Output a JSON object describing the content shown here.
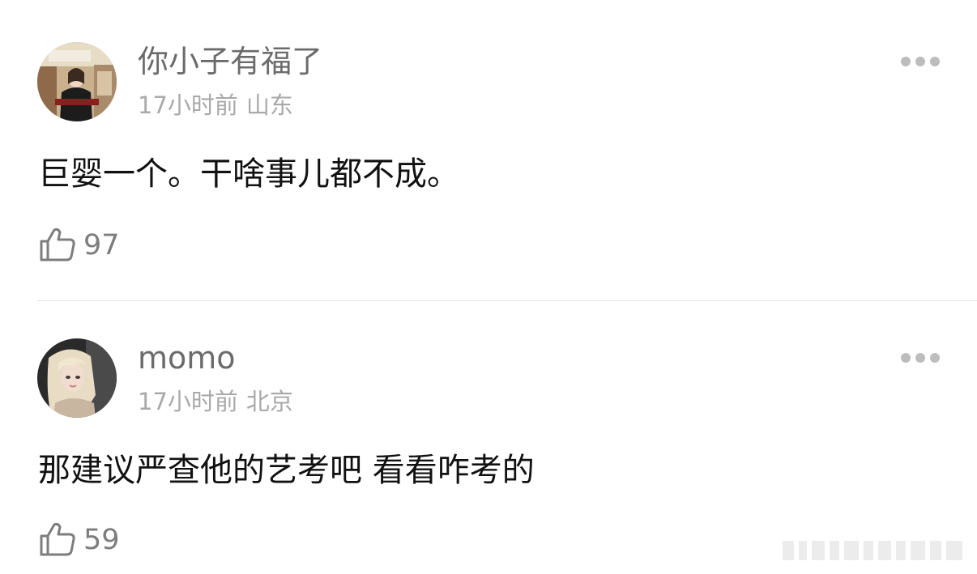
{
  "comments": [
    {
      "username": "你小子有福了",
      "time": "17小时前",
      "location": "山东",
      "text": "巨婴一个。干啥事儿都不成。",
      "likes": "97",
      "avatar_icon": "avatar-photo"
    },
    {
      "username": "momo",
      "time": "17小时前",
      "location": "北京",
      "text": "那建议严查他的艺考吧 看看咋考的",
      "likes": "59",
      "avatar_icon": "avatar-photo"
    }
  ],
  "icons": {
    "like": "thumbs-up-icon",
    "more": "more-dots-icon"
  },
  "colors": {
    "username": "#6b6b6b",
    "meta": "#a9a9a9",
    "text": "#111111",
    "icon": "#bdbdbd",
    "divider": "#e4e4e4"
  }
}
